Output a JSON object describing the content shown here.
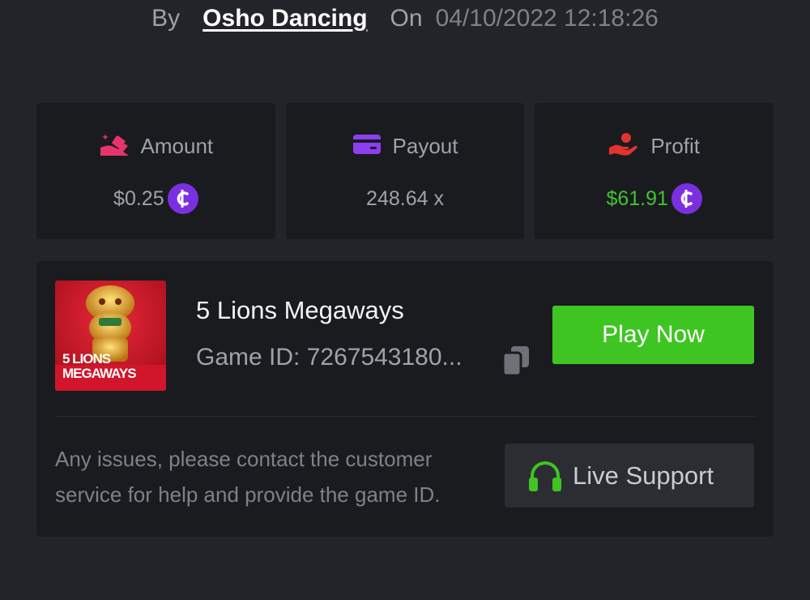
{
  "header": {
    "by_label": "By",
    "username": "Osho Dancing",
    "on_label": "On",
    "timestamp": "04/10/2022 12:18:26"
  },
  "stats": [
    {
      "label": "Amount",
      "value": "$0.25",
      "icon": "amount-icon",
      "icon_color": "#e8336d",
      "value_color": "#9ea2ab",
      "coin": true
    },
    {
      "label": "Payout",
      "value": "248.64 x",
      "icon": "card-icon",
      "icon_color": "#8b3ff0",
      "value_color": "#9ea2ab",
      "coin": false
    },
    {
      "label": "Profit",
      "value": "$61.91",
      "icon": "hand-profit-icon",
      "icon_color": "#e2332f",
      "value_color": "#3ec531",
      "coin": true
    }
  ],
  "coin_icon": "coin-icon",
  "game": {
    "name": "5 Lions Megaways",
    "id_text": "Game ID: 7267543180...",
    "thumbnail_text_line1": "5 LIONS",
    "thumbnail_text_line2": "MEGAWAYS",
    "play_label": "Play Now"
  },
  "support": {
    "help_line1": "Any issues, please contact the customer",
    "help_line2": "service for help and provide the game ID.",
    "button_label": "Live Support",
    "icon": "headset-icon"
  },
  "colors": {
    "background": "#232429",
    "card": "#1a1b1f",
    "accent_green": "#3ec522",
    "coin_purple": "#7b2fe0",
    "muted_text": "#9ea2ab"
  }
}
